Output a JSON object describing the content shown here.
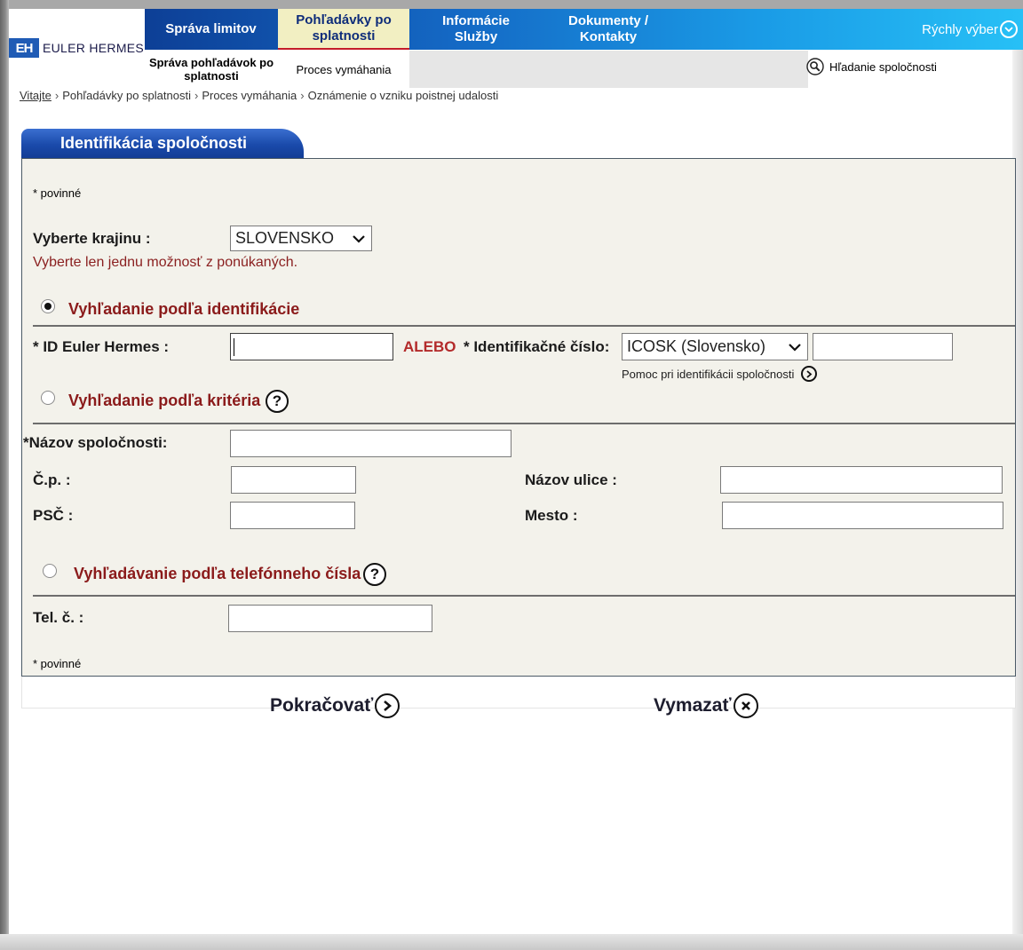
{
  "brand": {
    "logo_mark": "EH",
    "name": "EULER HERMES"
  },
  "nav": {
    "items": [
      {
        "label": "Správa limitov"
      },
      {
        "label": "Pohľadávky po splatnosti"
      },
      {
        "label": "Informácie Služby"
      },
      {
        "label": "Dokumenty / Kontakty"
      }
    ],
    "quick_select": "Rýchly výber"
  },
  "subnav": {
    "items": [
      {
        "label": "Správa pohľadávok po splatnosti"
      },
      {
        "label": "Proces vymáhania"
      }
    ],
    "company_search": "Hľadanie spoločnosti"
  },
  "breadcrumb": {
    "items": [
      "Vitajte",
      "Pohľadávky po splatnosti",
      "Proces vymáhania",
      "Oznámenie o vzniku poistnej udalosti"
    ],
    "separator": "›"
  },
  "panel": {
    "tab_title": "Identifikácia spoločnosti",
    "required_note_top": "* povinné",
    "required_note_bottom": "* povinné",
    "country": {
      "label": "Vyberte krajinu :",
      "selected": "SLOVENSKO",
      "hint": "Vyberte len jednu možnosť z ponúkaných."
    },
    "search_by_id": {
      "title": "Vyhľadanie podľa identifikácie",
      "selected": true,
      "eh_id_label": "* ID Euler Hermes :",
      "eh_id_value": "",
      "or_label": "ALEBO",
      "ident_label": "* Identifikačné číslo:",
      "ident_type_selected": "ICOSK (Slovensko)",
      "ident_value": "",
      "help_link": "Pomoc pri identifikácii spoločnosti"
    },
    "search_by_criteria": {
      "title": "Vyhľadanie podľa kritéria",
      "selected": false,
      "company_name_label": "Názov spoločnosti:",
      "house_no_label": "Č.p. :",
      "street_label": "Názov ulice :",
      "zip_label": "PSČ :",
      "city_label": "Mesto :"
    },
    "search_by_phone": {
      "title": "Vyhľadávanie podľa telefónneho čísla",
      "selected": false,
      "phone_label": "Tel. č. :"
    }
  },
  "actions": {
    "continue_label": "Pokračovať",
    "clear_label": "Vymazať"
  },
  "colors": {
    "nav_start": "#0d3f96",
    "nav_end": "#27c0f6",
    "nav_active_bg": "#f2efc2",
    "panel_bg": "#f3f2eb",
    "section_title": "#8b1b1b",
    "alebo": "#b32a2a"
  }
}
